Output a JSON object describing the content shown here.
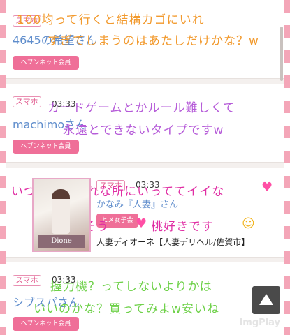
{
  "posts": [
    {
      "tag": "スマホ",
      "time": "",
      "name": "4645の希望さん",
      "member_label": "ヘブンネット会員",
      "handwriting": [
        "100均って行くと結構カゴにいれ",
        "すぎてしまうのはあたしだけかな？w"
      ]
    },
    {
      "tag": "スマホ",
      "time": "03:33",
      "name": "machimoさん",
      "member_label": "ヘブンネット会員",
      "handwriting": [
        "カードゲームとかルール難しくて",
        "永遠とできないタイプですw"
      ]
    },
    {
      "tag": "スマホ",
      "time": "03:33",
      "name": "かなみ『人妻』さん",
      "member_label": "ヒメ女子会",
      "shop": "人妻ディオーネ【人妻デリヘル/佐賀市】",
      "photo_label": "Dione",
      "handwriting": [
        "いつもおしゃれな所にいっててイイな",
        "桃おいしそう",
        "桃好きです"
      ]
    },
    {
      "tag": "スマホ",
      "time": "03:33",
      "name": "シブスパさん",
      "member_label": "ヘブンネット会員",
      "handwriting": [
        "握力機？ってしないよりかは",
        "いいのかな？買ってみよw安いね"
      ]
    }
  ],
  "icons": {
    "heart": "♥",
    "smile": "☺",
    "scroll_top": "scroll-to-top-icon"
  },
  "watermark": "ImgPlay",
  "colors": {
    "accent": "#ef6f98",
    "name": "#5f8dcc",
    "stripe": "#f4a6b8"
  }
}
